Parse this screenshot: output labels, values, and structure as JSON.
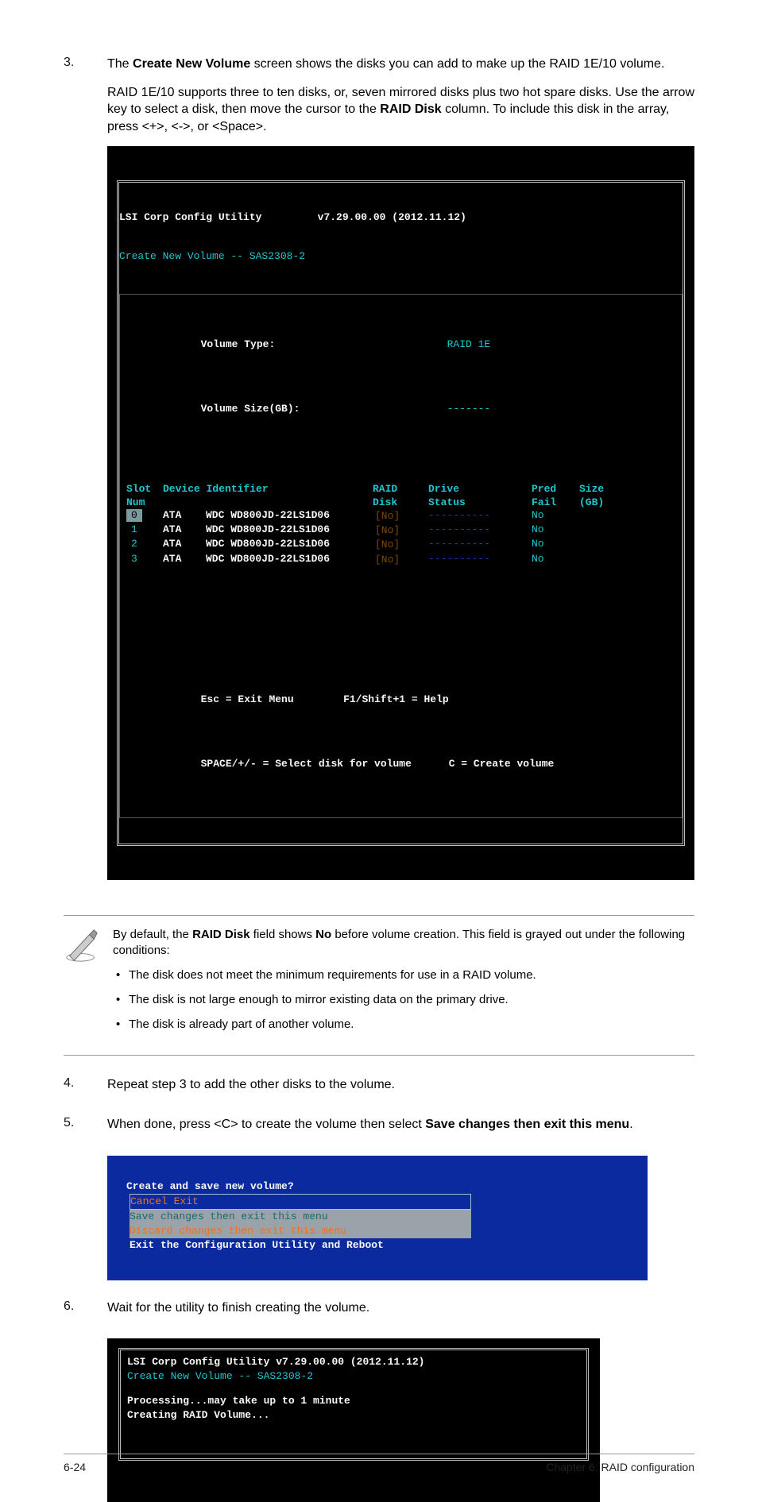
{
  "step3": {
    "num": "3.",
    "p1_a": "The ",
    "p1_b": "Create New Volume",
    "p1_c": " screen shows the disks you can add to make up the RAID 1E/10 volume.",
    "p2_a": "RAID 1E/10 supports three to ten disks, or, seven mirrored disks plus two hot spare disks. Use the arrow key to select a disk, then move the cursor to the ",
    "p2_b": "RAID Disk",
    "p2_c": " column. To include this disk in the array, press <+>, <->, or <Space>."
  },
  "term1": {
    "title": "LSI Corp Config Utility",
    "version": "v7.29.00.00 (2012.11.12)",
    "subtitle": "Create New Volume -- SAS2308-2",
    "voltype_label": "Volume Type:",
    "voltype_value": "RAID 1E",
    "volsize_label": "Volume Size(GB):",
    "volsize_value": "-------",
    "cols": {
      "slot1": "Slot",
      "slot2": "Num",
      "dev": "Device Identifier",
      "raid1": "RAID",
      "raid2": "Disk",
      "drive1": "Drive",
      "drive2": "Status",
      "pred1": "Pred",
      "pred2": "Fail",
      "size1": "Size",
      "size2": "(GB)"
    },
    "rows": [
      {
        "num": "0",
        "dev1": "ATA",
        "dev2": "WDC WD800JD-22LS1D06",
        "rd": "[No]",
        "ds": "----------",
        "pf": "No"
      },
      {
        "num": "1",
        "dev1": "ATA",
        "dev2": "WDC WD800JD-22LS1D06",
        "rd": "[No]",
        "ds": "----------",
        "pf": "No"
      },
      {
        "num": "2",
        "dev1": "ATA",
        "dev2": "WDC WD800JD-22LS1D06",
        "rd": "[No]",
        "ds": "----------",
        "pf": "No"
      },
      {
        "num": "3",
        "dev1": "ATA",
        "dev2": "WDC WD800JD-22LS1D06",
        "rd": "[No]",
        "ds": "----------",
        "pf": "No"
      }
    ],
    "foot1a": "Esc = Exit Menu",
    "foot1b": "F1/Shift+1 = Help",
    "foot2a": "SPACE/+/- = Select disk for volume",
    "foot2b": "C = Create volume"
  },
  "note": {
    "lead_a": "By default, the ",
    "lead_b": "RAID Disk",
    "lead_c": " field shows ",
    "lead_d": "No",
    "lead_e": " before volume creation. This field is grayed out under the following conditions:",
    "bul1": "The disk does not meet the minimum requirements for use in a RAID volume.",
    "bul2": "The disk is not large enough to mirror existing data on the primary drive.",
    "bul3": "The disk is already part of another volume."
  },
  "step4": {
    "num": "4.",
    "text": "Repeat step 3 to add the other disks to the volume."
  },
  "step5": {
    "num": "5.",
    "a": "When done, press <C> to create the volume then select ",
    "b": "Save changes then exit this menu",
    "c": "."
  },
  "bluebox": {
    "title": "Create and save new volume?",
    "m1": "Cancel Exit",
    "m2": "Save changes then exit this menu",
    "m3": "Discard changes then exit this menu",
    "m4": "Exit the Configuration Utility and Reboot"
  },
  "step6": {
    "num": "6.",
    "text": "Wait for the utility to finish creating the volume."
  },
  "proc": {
    "title": "LSI Corp Config Utility",
    "version": "v7.29.00.00 (2012.11.12)",
    "subtitle": "Create New Volume -- SAS2308-2",
    "l1": "Processing...may take up to 1 minute",
    "l2": "Creating RAID Volume..."
  },
  "footer": {
    "left": "6-24",
    "right": "Chapter 6: RAID configuration"
  }
}
